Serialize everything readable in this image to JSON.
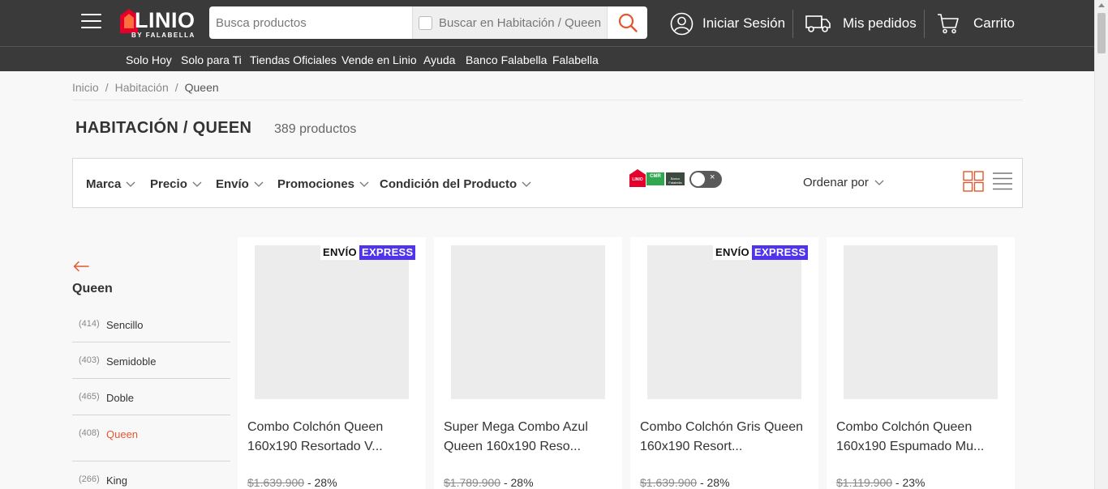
{
  "header": {
    "logo_text": "LINIO",
    "logo_sub": "BY FALABELLA",
    "search_placeholder": "Busca productos",
    "search_scope_label": "Buscar en Habitación / Queen",
    "login_label": "Iniciar Sesión",
    "orders_label": "Mis pedidos",
    "cart_label": "Carrito"
  },
  "nav": [
    "Solo Hoy",
    "Solo para Ti",
    "Tiendas Oficiales",
    "Vende en Linio",
    "Ayuda",
    "Banco Falabella",
    "Falabella"
  ],
  "breadcrumb": [
    "Inicio",
    "Habitación",
    "Queen"
  ],
  "page": {
    "title": "HABITACIÓN / QUEEN",
    "count": "389 productos"
  },
  "filters": {
    "items": [
      "Marca",
      "Precio",
      "Envío",
      "Promociones",
      "Condición del Producto"
    ],
    "sort_label": "Ordenar por",
    "promo_badges": [
      "LINIO",
      "CMR",
      "Banco Falabella"
    ],
    "toggle_x": "×"
  },
  "sidebar": {
    "title": "Queen",
    "items": [
      {
        "count": "(414)",
        "label": "Sencillo"
      },
      {
        "count": "(403)",
        "label": "Semidoble"
      },
      {
        "count": "(465)",
        "label": "Doble"
      },
      {
        "count": "(408)",
        "label": "Queen"
      },
      {
        "count": "(266)",
        "label": "King"
      }
    ]
  },
  "express_badge": {
    "a": "ENVÍO",
    "b": "EXPRESS"
  },
  "products": [
    {
      "title": "Combo Colchón Queen 160x190 Resortado V...",
      "old_price": "$1.639.900",
      "discount": "- 28%",
      "express": true
    },
    {
      "title": "Super Mega Combo Azul Queen 160x190 Reso...",
      "old_price": "$1.789.900",
      "discount": "- 28%",
      "express": false
    },
    {
      "title": "Combo Colchón Gris Queen 160x190 Resort...",
      "old_price": "$1.639.900",
      "discount": "- 28%",
      "express": true
    },
    {
      "title": "Combo Colchón Queen 160x190 Espumado Mu...",
      "old_price": "$1.119.900",
      "discount": "- 23%",
      "express": false
    }
  ],
  "colors": {
    "header_bg": "#3a3a3a",
    "accent": "#e4572e",
    "express": "#5034ed"
  }
}
